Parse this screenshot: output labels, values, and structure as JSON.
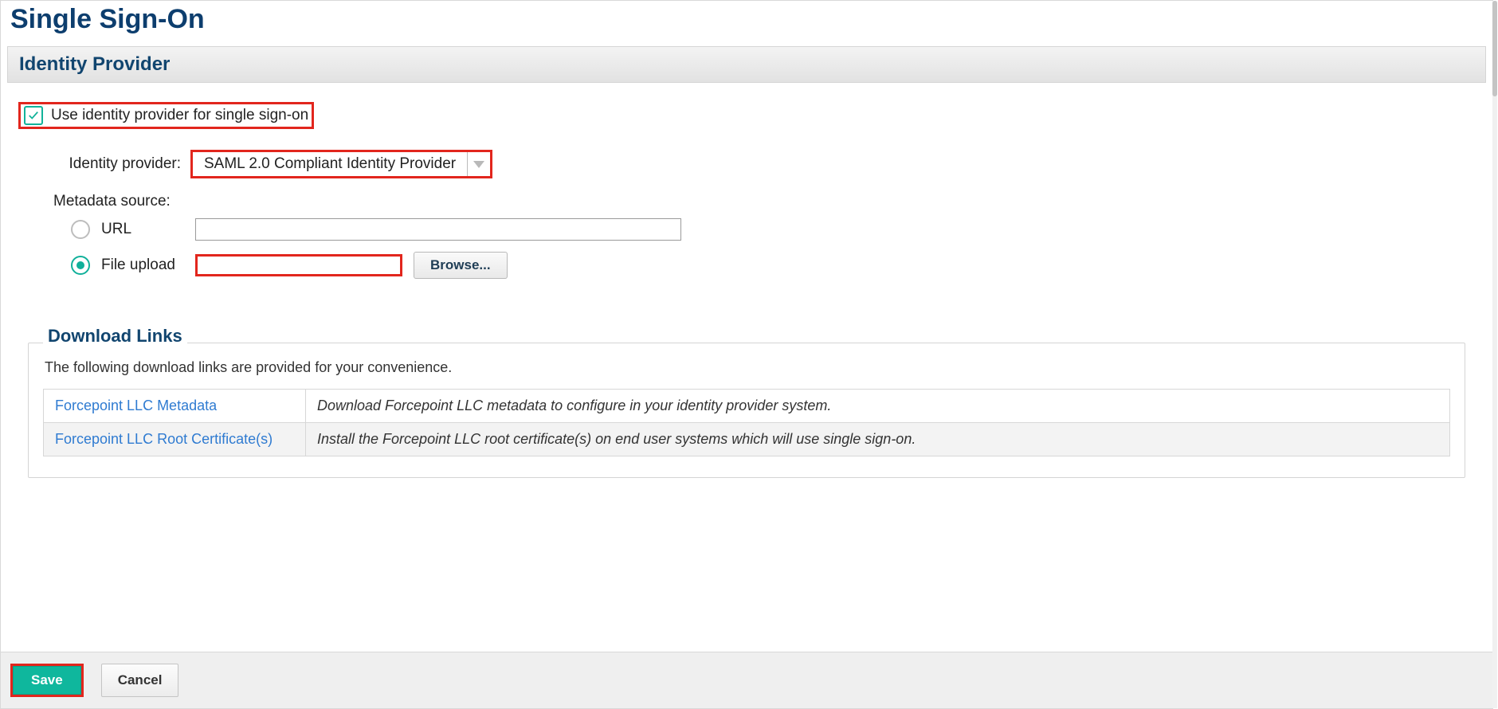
{
  "page": {
    "title": "Single Sign-On"
  },
  "identity_provider_section": {
    "header": "Identity Provider",
    "use_idp_checkbox": {
      "label": "Use identity provider for single sign-on",
      "checked": true
    },
    "idp_select": {
      "label": "Identity provider:",
      "value": "SAML 2.0 Compliant Identity Provider"
    },
    "metadata_source": {
      "label": "Metadata source:",
      "options": {
        "url": {
          "label": "URL",
          "selected": false,
          "value": ""
        },
        "file_upload": {
          "label": "File upload",
          "selected": true,
          "value": "",
          "browse_label": "Browse..."
        }
      }
    }
  },
  "download_links": {
    "legend": "Download Links",
    "description": "The following download links are provided for your convenience.",
    "rows": [
      {
        "link_text": "Forcepoint LLC Metadata",
        "description": "Download Forcepoint LLC metadata to configure in your identity provider system."
      },
      {
        "link_text": "Forcepoint LLC Root Certificate(s)",
        "description": "Install the Forcepoint LLC root certificate(s) on end user systems which will use single sign-on."
      }
    ]
  },
  "footer": {
    "save_label": "Save",
    "cancel_label": "Cancel"
  }
}
